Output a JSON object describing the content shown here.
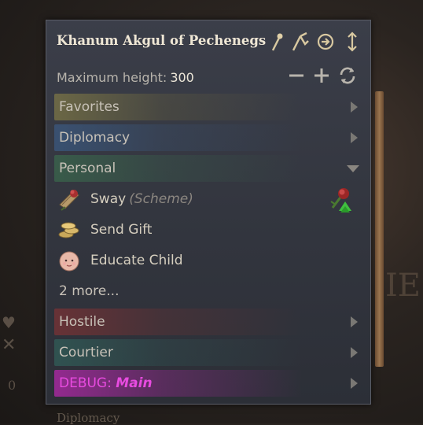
{
  "window": {
    "title": "Khanum Akgul of Pechenegs",
    "icons": [
      "pin-icon",
      "tools-icon",
      "goto-icon",
      "resize-vertical-icon"
    ]
  },
  "height_control": {
    "label": "Maximum height:",
    "value": "300",
    "icons": [
      "minus-icon",
      "plus-icon",
      "reset-icon"
    ]
  },
  "categories": {
    "favorites": "Favorites",
    "diplomacy": "Diplomacy",
    "personal": "Personal",
    "hostile": "Hostile",
    "courtier": "Courtier",
    "debug_prefix": "DEBUG:",
    "debug_name": "Main"
  },
  "actions": [
    {
      "label": "Sway",
      "sub": "(Scheme)",
      "icon": "sway-scroll-icon",
      "badge": "rose-upgrade-icon"
    },
    {
      "label": "Send Gift",
      "icon": "gold-coins-icon"
    },
    {
      "label": "Educate Child",
      "icon": "baby-icon"
    }
  ],
  "more_label": "2 more...",
  "background": {
    "word": "Diplomacy",
    "count": "0",
    "letters": "IE"
  },
  "colors": {
    "panel": "#353843",
    "title": "#efe7d5",
    "debug": "#e84be0",
    "scrollbar": "#9a7550"
  }
}
